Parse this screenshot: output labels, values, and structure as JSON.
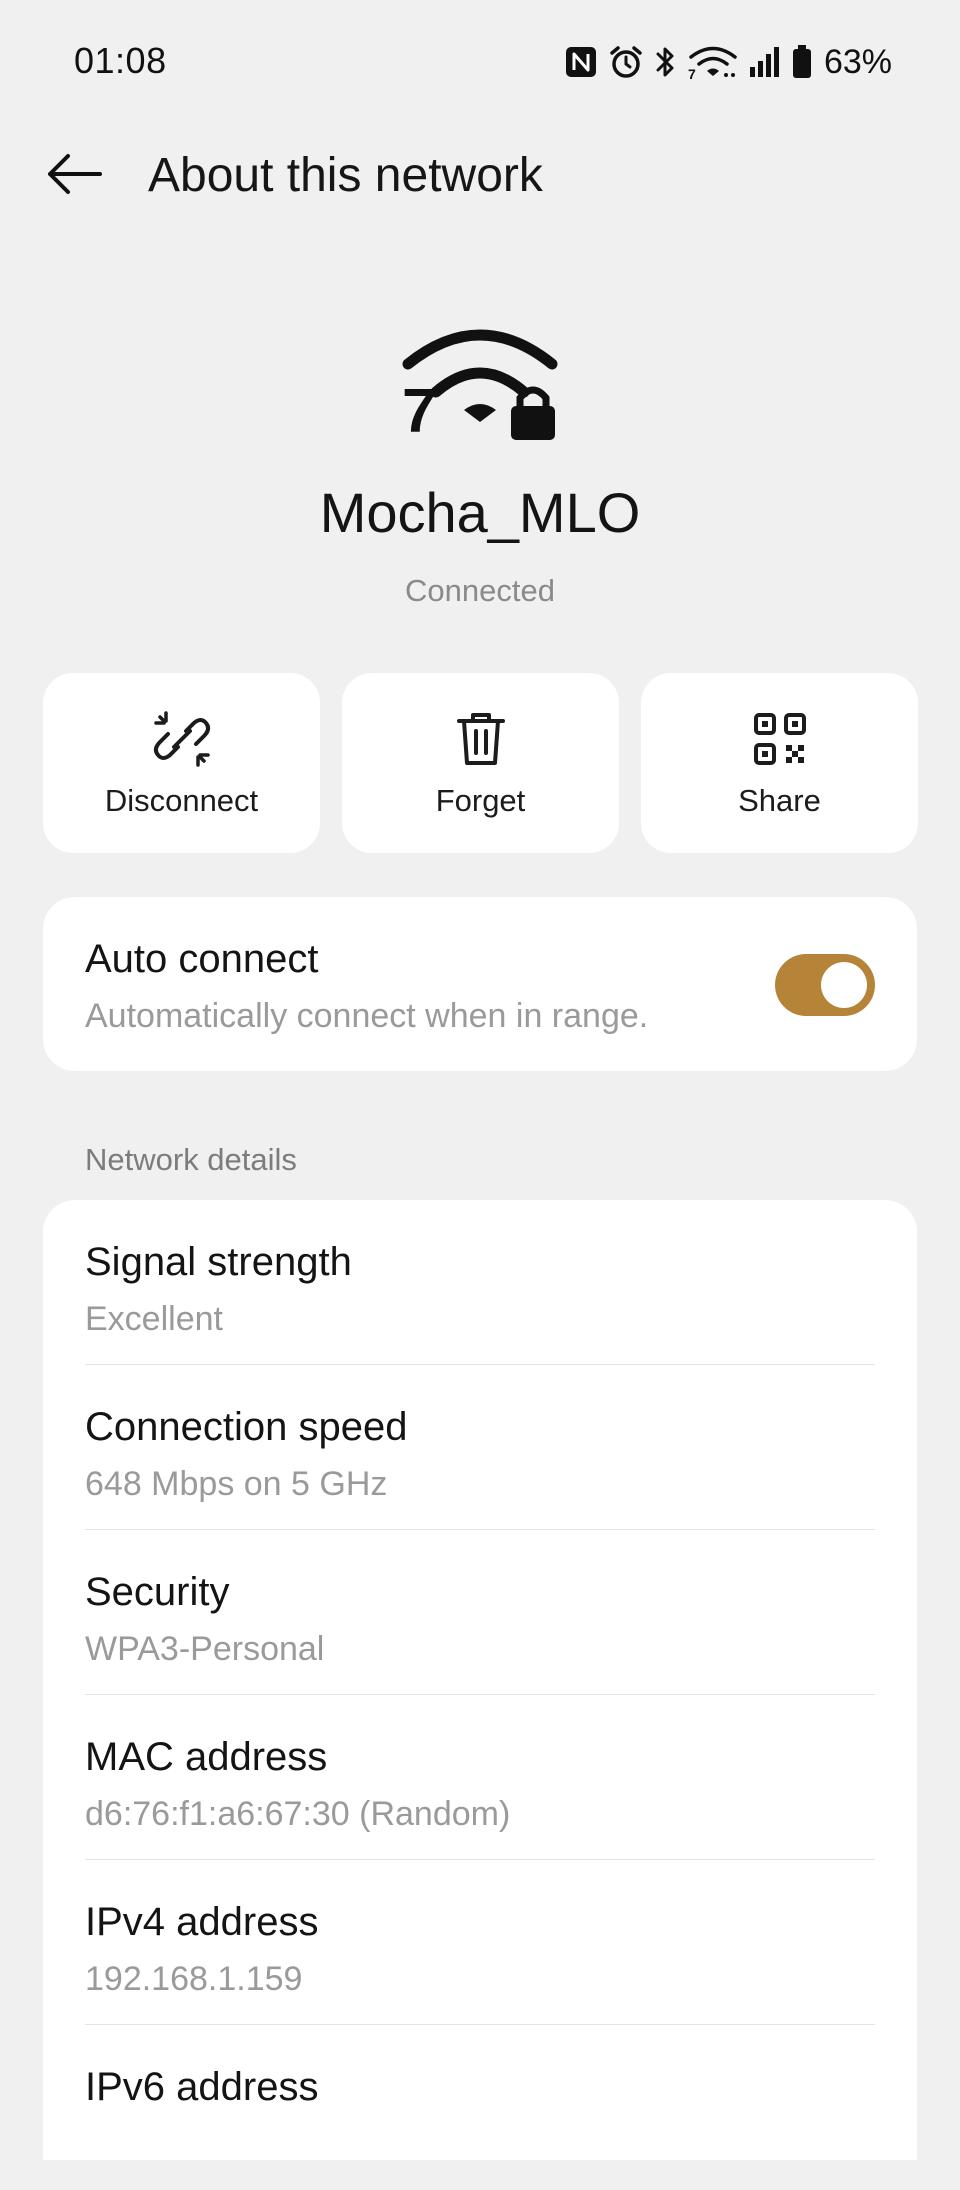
{
  "status_bar": {
    "time": "01:08",
    "battery_percent": "63%",
    "icons": [
      "nfc-icon",
      "alarm-icon",
      "bluetooth-icon",
      "wifi-7-icon",
      "cell-signal-icon",
      "battery-icon"
    ]
  },
  "app_bar": {
    "title": "About this network",
    "back_icon": "arrow-left-icon"
  },
  "network": {
    "name": "Mocha_MLO",
    "status": "Connected",
    "icon": "wifi-7-locked-icon"
  },
  "actions": [
    {
      "label": "Disconnect",
      "icon": "broken-link-icon"
    },
    {
      "label": "Forget",
      "icon": "trash-icon"
    },
    {
      "label": "Share",
      "icon": "qr-code-icon"
    }
  ],
  "auto_connect": {
    "title": "Auto connect",
    "subtitle": "Automatically connect when in range.",
    "enabled": true
  },
  "details": {
    "section_title": "Network details",
    "rows": [
      {
        "label": "Signal strength",
        "value": "Excellent"
      },
      {
        "label": "Connection speed",
        "value": "648 Mbps on 5 GHz"
      },
      {
        "label": "Security",
        "value": "WPA3-Personal"
      },
      {
        "label": "MAC address",
        "value": "d6:76:f1:a6:67:30 (Random)"
      },
      {
        "label": "IPv4 address",
        "value": "192.168.1.159"
      },
      {
        "label": "IPv6 address",
        "value": ""
      }
    ]
  },
  "colors": {
    "background": "#f0f0f0",
    "card": "#ffffff",
    "accent": "#b68438",
    "primary_text": "#141414",
    "secondary_text": "#9a9a9a"
  }
}
